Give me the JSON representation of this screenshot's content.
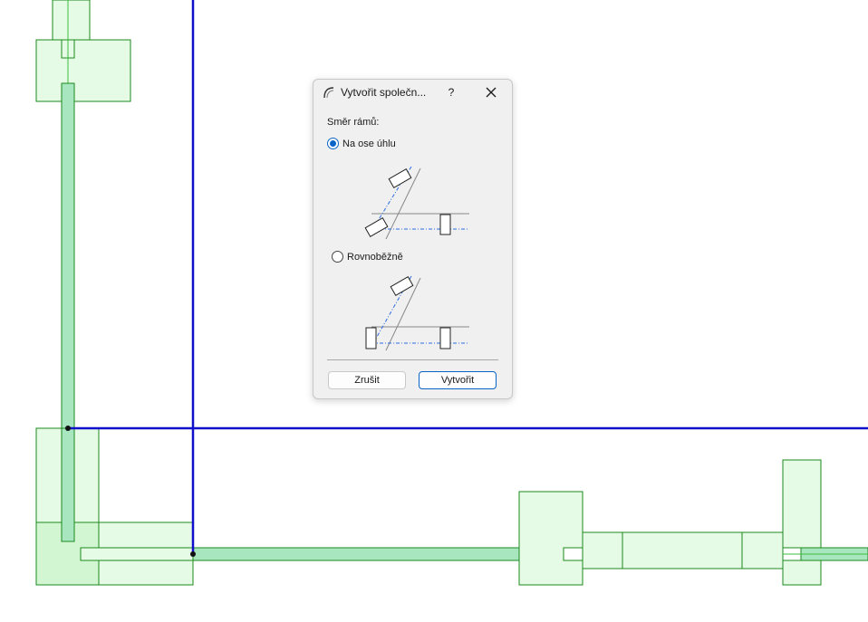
{
  "dialog": {
    "title": "Vytvořit společn...",
    "help_label": "?",
    "section_label": "Směr rámů:",
    "options": [
      {
        "label": "Na ose úhlu",
        "selected": true
      },
      {
        "label": "Rovnoběžně",
        "selected": false
      }
    ],
    "cancel_label": "Zrušit",
    "create_label": "Vytvořit"
  },
  "colors": {
    "accent": "#0a64c8",
    "axis_line": "#1010cc",
    "wall_fill": "#e6fbe6",
    "wall_stroke": "#1c8a1c",
    "wall_core": "#a8e6c0"
  },
  "icons": {
    "app": "curve-icon",
    "close": "close-icon"
  }
}
